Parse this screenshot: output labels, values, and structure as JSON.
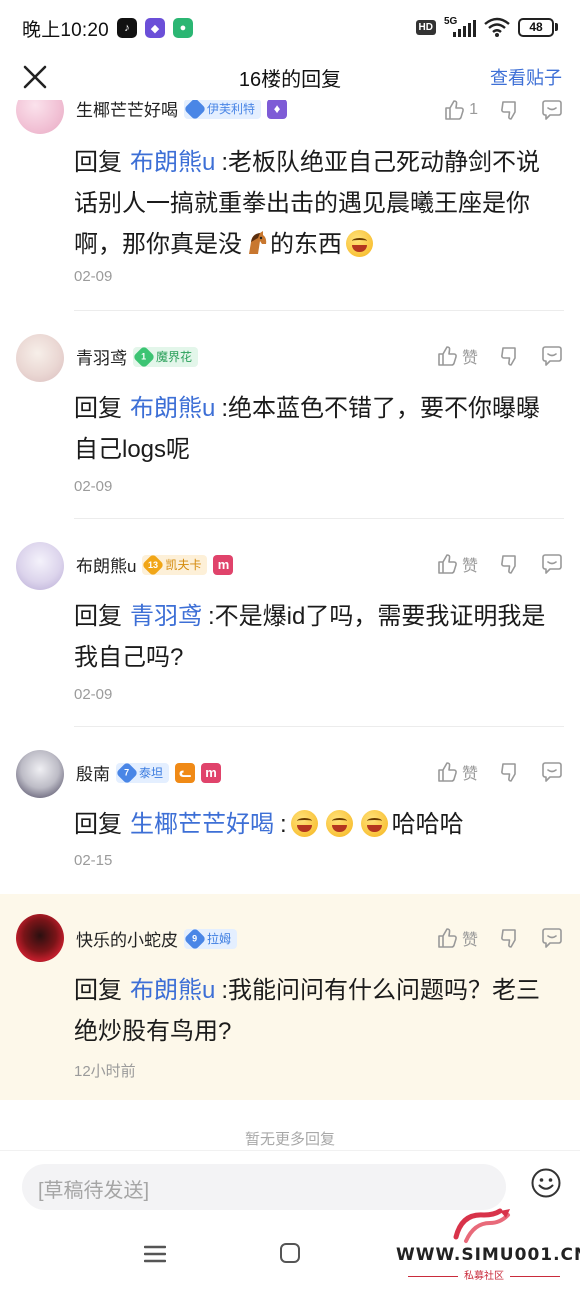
{
  "status_bar": {
    "time": "晚上10:20",
    "hd": "HD",
    "network": "5G",
    "battery": "48"
  },
  "nav": {
    "title": "16楼的回复",
    "view_post": "查看贴子"
  },
  "actions": {
    "like": "赞",
    "partial_top_count": "1"
  },
  "replies": [
    {
      "user": "生椰芒芒好喝",
      "badge": "伊芙利特",
      "reply_word": "回复",
      "target": "布朗熊u",
      "text_before_icon": ":老板队绝亚自己死动静剑不说话别人一搞就重拳出击的遇见晨曦王座是你啊，那你真是没",
      "text_after_icon": "的东西",
      "horse_icon": "horse-emoji",
      "date": "02-09"
    },
    {
      "user": "青羽鸢",
      "level": "1",
      "badge": "魔界花",
      "reply_word": "回复",
      "target": "布朗熊u",
      "text": ":绝本蓝色不错了，要不你曝曝自己logs呢",
      "date": "02-09"
    },
    {
      "user": "布朗熊u",
      "level": "13",
      "badge": "凯夫卡",
      "mark": "m",
      "reply_word": "回复",
      "target": "青羽鸢",
      "text": ":不是爆id了吗，需要我证明我是我自己吗?",
      "date": "02-09"
    },
    {
      "user": "殷南",
      "level": "7",
      "badge": "泰坦",
      "mark1": "ᓚ",
      "mark": "m",
      "reply_word": "回复",
      "target": "生椰芒芒好喝",
      "text": "哈哈哈",
      "date": "02-15"
    },
    {
      "user": "快乐的小蛇皮",
      "level": "9",
      "badge": "拉姆",
      "reply_word": "回复",
      "target": "布朗熊u",
      "text": ":我能问问有什么问题吗？老三绝炒股有鸟用?",
      "date": "12小时前"
    }
  ],
  "no_more": "暂无更多回复",
  "input": {
    "placeholder": "[草稿待发送]"
  },
  "watermark": {
    "url": "WWW.SIMU001.CN",
    "sub": "私募社区"
  },
  "colors": {
    "link": "#3d6fd6",
    "highlight_bg": "#fdf8ea"
  }
}
